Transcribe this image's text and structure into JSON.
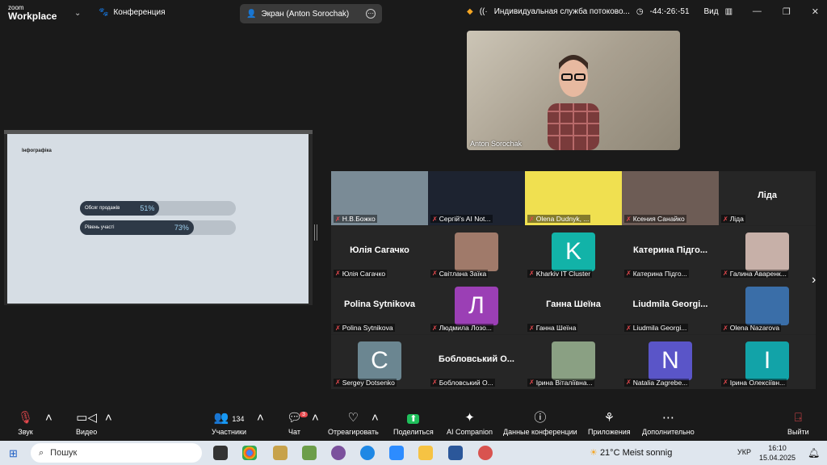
{
  "app": {
    "logo_top": "zoom",
    "logo_bottom": "Workplace",
    "conference": "Конференция"
  },
  "share": {
    "label": "Экран (Anton Sorochak)"
  },
  "topbar": {
    "service": "Индивидуальная служба потоково...",
    "timer": "-44:-26:-51",
    "view": "Вид"
  },
  "slide": {
    "title": "Інфографіка",
    "bars": [
      {
        "label": "Обсяг продажів",
        "pct": "51%",
        "fill": 0.51
      },
      {
        "label": "Рівень участі",
        "pct": "73%",
        "fill": 0.73
      }
    ]
  },
  "speaker": {
    "name": "Anton Sorochak"
  },
  "participants": [
    {
      "name": "Н.В.Божко",
      "kind": "photo",
      "color": "#7a8b96"
    },
    {
      "name": "Сергій's AI Not...",
      "kind": "photo",
      "color": "#1d2330"
    },
    {
      "name": "Olena Dudnyk, ...",
      "kind": "photo",
      "color": "#f0e050"
    },
    {
      "name": "Ксения Санайко",
      "kind": "photo",
      "color": "#6d5c55"
    },
    {
      "name": "Ліда",
      "kind": "text",
      "big": "Ліда"
    },
    {
      "name": "Юлія Сагачко",
      "kind": "text",
      "big": "Юлія Сагачко"
    },
    {
      "name": "Світлана Заїка",
      "kind": "photo",
      "color": "#a07a6a"
    },
    {
      "name": "Kharkiv IT Cluster",
      "kind": "avatar",
      "letter": "K",
      "color": "#12b3a8"
    },
    {
      "name": "Катерина Підго...",
      "kind": "text",
      "big": "Катерина Підго..."
    },
    {
      "name": "Галина Аваренк...",
      "kind": "photo",
      "color": "#c7b0a8"
    },
    {
      "name": "Polina Sytnikova",
      "kind": "text",
      "big": "Polina Sytnikova"
    },
    {
      "name": "Людмила Лозо...",
      "kind": "avatar",
      "letter": "Л",
      "color": "#9b3fb5"
    },
    {
      "name": "Ганна Шеїна",
      "kind": "text",
      "big": "Ганна Шеїна"
    },
    {
      "name": "Liudmila Georgi...",
      "kind": "text",
      "big": "Liudmila Georgi..."
    },
    {
      "name": "Olena Nazarova",
      "kind": "photo",
      "color": "#3a6ea8"
    },
    {
      "name": "Sergey Dotsenko",
      "kind": "avatar",
      "letter": "C",
      "color": "#6b8691"
    },
    {
      "name": "Бобловський О...",
      "kind": "text",
      "big": "Бобловський О..."
    },
    {
      "name": "Ірина Віталіївна...",
      "kind": "photo",
      "color": "#8aa083"
    },
    {
      "name": "Natalia Zagrebe...",
      "kind": "avatar",
      "letter": "N",
      "color": "#5a55c8"
    },
    {
      "name": "Ірина Олексіївн...",
      "kind": "avatar",
      "letter": "I",
      "color": "#12a3a8"
    }
  ],
  "controls": {
    "audio": "Звук",
    "video": "Видео",
    "participants": "Участники",
    "participants_count": "134",
    "chat": "Чат",
    "chat_badge": "3",
    "react": "Отреагировать",
    "share": "Поделиться",
    "ai": "AI Companion",
    "info": "Данные конференции",
    "apps": "Приложения",
    "more": "Дополнительно",
    "leave": "Выйти"
  },
  "taskbar": {
    "search": "Пошук",
    "weather": "21°C  Meist sonnig",
    "lang": "УКР",
    "time": "16:10",
    "date": "15.04.2025"
  }
}
